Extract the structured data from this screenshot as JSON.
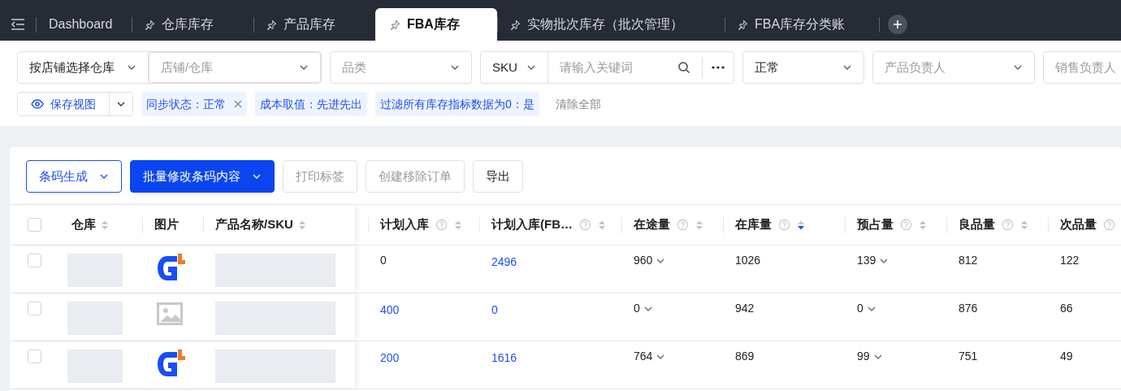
{
  "tabs": [
    {
      "label": "Dashboard",
      "pinned": false,
      "selected": false
    },
    {
      "label": "仓库库存",
      "pinned": true,
      "selected": false
    },
    {
      "label": "产品库存",
      "pinned": true,
      "selected": false
    },
    {
      "label": "FBA库存",
      "pinned": true,
      "selected": true
    },
    {
      "label": "实物批次库存（批次管理）",
      "pinned": true,
      "selected": false
    },
    {
      "label": "FBA库存分类账",
      "pinned": true,
      "selected": false
    }
  ],
  "filters": {
    "warehouse_mode": {
      "value": "按店铺选择仓库"
    },
    "warehouse": {
      "placeholder": "店铺/仓库"
    },
    "category": {
      "placeholder": "品类"
    },
    "search_field": {
      "value": "SKU"
    },
    "search": {
      "placeholder": "请输入关键词"
    },
    "status": {
      "value": "正常"
    },
    "product_owner": {
      "placeholder": "产品负责人"
    },
    "sales_owner": {
      "placeholder": "销售负责人"
    }
  },
  "save_view": {
    "label": "保存视图"
  },
  "tags": [
    {
      "label": "同步状态：正常",
      "closable": true
    },
    {
      "label": "成本取值：先进先出",
      "closable": false
    },
    {
      "label": "过滤所有库存指标数据为0：是",
      "closable": false
    }
  ],
  "clear_all": "清除全部",
  "toolbar": [
    {
      "label": "条码生成",
      "kind": "outline",
      "dropdown": true,
      "disabled": false
    },
    {
      "label": "批量修改条码内容",
      "kind": "primary",
      "dropdown": true,
      "disabled": false
    },
    {
      "label": "打印标签",
      "kind": "default",
      "dropdown": false,
      "disabled": true
    },
    {
      "label": "创建移除订单",
      "kind": "default",
      "dropdown": false,
      "disabled": true
    },
    {
      "label": "导出",
      "kind": "default",
      "dropdown": false,
      "disabled": false
    }
  ],
  "table": {
    "select_all": {
      "checked": false
    },
    "fixed_columns": [
      {
        "label": "仓库",
        "sort_desc": false
      },
      {
        "label": "图片"
      },
      {
        "label": "产品名称/SKU",
        "sort_desc": false
      }
    ],
    "columns": [
      {
        "label": "计划入库",
        "help": true,
        "sort_desc": false
      },
      {
        "label": "计划入库(FB…",
        "help": true,
        "sort_desc": false
      },
      {
        "label": "在途量",
        "help": true,
        "sort_desc": false
      },
      {
        "label": "在库量",
        "help": true,
        "sort_desc": true
      },
      {
        "label": "预占量",
        "help": true,
        "sort_desc": false
      },
      {
        "label": "良品量",
        "help": true,
        "sort_desc": false
      },
      {
        "label": "次品量",
        "help": true
      }
    ],
    "rows": [
      {
        "checked": false,
        "kind": "logo",
        "cells": [
          {
            "text": "0",
            "kind": "plain"
          },
          {
            "text": "2496",
            "kind": "link"
          },
          {
            "text": "960",
            "kind": "dropdown"
          },
          {
            "text": "1026",
            "kind": "plain"
          },
          {
            "text": "139",
            "kind": "dropdown"
          },
          {
            "text": "812",
            "kind": "plain"
          },
          {
            "text": "122",
            "kind": "plain"
          }
        ]
      },
      {
        "checked": false,
        "kind": "placeholder",
        "cells": [
          {
            "text": "400",
            "kind": "link"
          },
          {
            "text": "0",
            "kind": "link"
          },
          {
            "text": "0",
            "kind": "dropdown"
          },
          {
            "text": "942",
            "kind": "plain"
          },
          {
            "text": "0",
            "kind": "dropdown"
          },
          {
            "text": "876",
            "kind": "plain"
          },
          {
            "text": "66",
            "kind": "plain"
          }
        ]
      },
      {
        "checked": false,
        "kind": "logo",
        "cells": [
          {
            "text": "200",
            "kind": "link"
          },
          {
            "text": "1616",
            "kind": "link"
          },
          {
            "text": "764",
            "kind": "dropdown"
          },
          {
            "text": "869",
            "kind": "plain"
          },
          {
            "text": "99",
            "kind": "dropdown"
          },
          {
            "text": "751",
            "kind": "plain"
          },
          {
            "text": "49",
            "kind": "plain"
          }
        ]
      }
    ]
  }
}
